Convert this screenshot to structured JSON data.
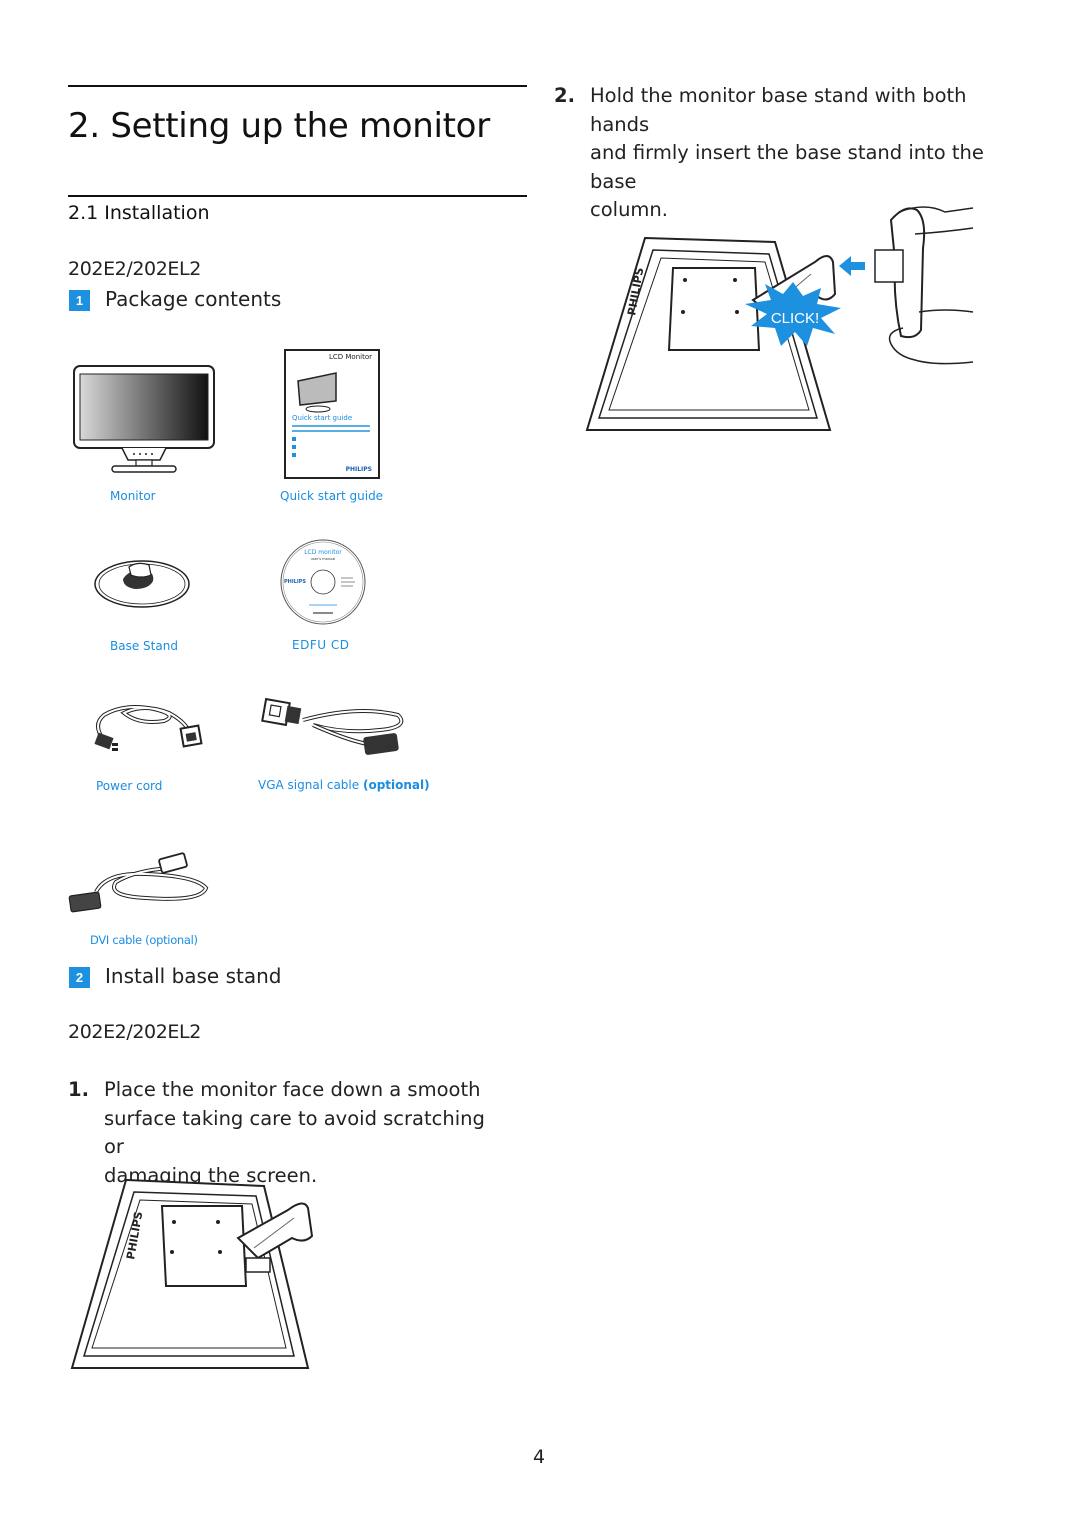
{
  "header": {
    "chapter_title": "2. Setting up the monitor",
    "section_title": "2.1 Installation"
  },
  "package": {
    "model": "202E2/202EL2",
    "step_number": "1",
    "step_title": "Package contents",
    "items": [
      {
        "label": "Monitor",
        "icon": "monitor-illustration"
      },
      {
        "label": "Quick start guide",
        "icon": "quick-start-guide-illustration"
      },
      {
        "label": "Base Stand",
        "icon": "base-stand-illustration"
      },
      {
        "label": "EDFU CD",
        "icon": "cd-illustration"
      },
      {
        "label": "Power cord",
        "icon": "power-cord-illustration"
      },
      {
        "label": "VGA signal cable",
        "label_suffix": "(optional)",
        "icon": "vga-cable-illustration"
      },
      {
        "label": "DVI cable (optional)",
        "icon": "dvi-cable-illustration"
      }
    ],
    "guide_cover": {
      "title": "LCD Monitor",
      "subtitle": "Quick start guide",
      "brand": "PHILIPS"
    },
    "cd_label": {
      "title": "LCD monitor",
      "subtitle": "user's manual",
      "brand": "PHILIPS"
    }
  },
  "install": {
    "step_number": "2",
    "step_title": "Install base stand",
    "model": "202E2/202EL2",
    "instructions": [
      {
        "num": "1.",
        "lines": [
          "Place the monitor face down a smooth",
          "surface taking care to avoid scratching or",
          "damaging the screen."
        ]
      },
      {
        "num": "2.",
        "lines": [
          "Hold the monitor base stand with both hands",
          "and firmly insert the base stand into the base",
          "column."
        ]
      }
    ],
    "click_label": "CLICK!",
    "brand_on_monitor": "PHILIPS"
  },
  "footer": {
    "page_number": "4"
  },
  "colors": {
    "accent": "#1e90e0",
    "caption": "#1a8ee0",
    "text": "#222222"
  }
}
